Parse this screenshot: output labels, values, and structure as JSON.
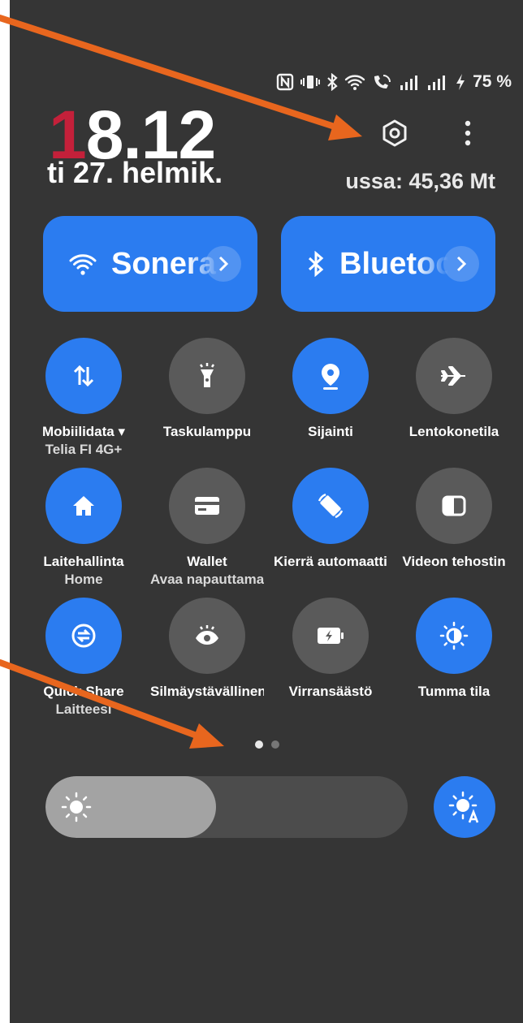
{
  "status_bar": {
    "battery_percent": "75 %",
    "icons": [
      "nfc-icon",
      "vibrate-icon",
      "bluetooth-icon",
      "wifi-icon",
      "wifi-calling-icon",
      "signal-icon",
      "signal-icon",
      "charging-icon"
    ]
  },
  "header": {
    "clock_first": "1",
    "clock_rest": "8.12",
    "date": "ti 27. helmik.",
    "data_usage": "ussa: 45,36 Mt"
  },
  "big_tiles": {
    "wifi": {
      "label": "Sonera",
      "icon": "wifi-icon"
    },
    "bluetooth": {
      "label": "Bluetooth",
      "icon": "bluetooth-icon"
    }
  },
  "quick_settings": [
    {
      "label": "Mobiilidata ▾",
      "sub": "Telia FI 4G+",
      "icon": "mobile-data-icon",
      "state": "on"
    },
    {
      "label": "Taskulamppu",
      "sub": "",
      "icon": "flashlight-icon",
      "state": "off"
    },
    {
      "label": "Sijainti",
      "sub": "",
      "icon": "location-icon",
      "state": "on"
    },
    {
      "label": "Lentokonetila",
      "sub": "",
      "icon": "airplane-icon",
      "state": "off"
    },
    {
      "label": "Laitehallinta",
      "sub": "Home",
      "icon": "home-icon",
      "state": "on"
    },
    {
      "label": "Wallet",
      "sub": "Avaa napauttamalla",
      "icon": "wallet-icon",
      "state": "off"
    },
    {
      "label": "Kierrä automaattisesti",
      "sub": "",
      "icon": "auto-rotate-icon",
      "state": "on"
    },
    {
      "label": "Videon tehostin",
      "sub": "",
      "icon": "video-enhancer-icon",
      "state": "off"
    },
    {
      "label": "Quick Share",
      "sub": "Laitteesi",
      "icon": "quick-share-icon",
      "state": "on"
    },
    {
      "label": "Silmäystävällinen",
      "sub": "",
      "icon": "eye-comfort-icon",
      "state": "off"
    },
    {
      "label": "Virransäästö",
      "sub": "",
      "icon": "power-saving-icon",
      "state": "off"
    },
    {
      "label": "Tumma tila",
      "sub": "",
      "icon": "dark-mode-icon",
      "state": "on"
    }
  ],
  "pager": {
    "pages": 2,
    "current": 1
  },
  "brightness": {
    "level_percent": 47,
    "auto_icon": "auto-brightness-icon"
  },
  "colors": {
    "panel": "#353535",
    "accent": "#2b7cf0",
    "tile_off": "#5a5a5a",
    "clock_accent": "#c4203a",
    "annotation_arrow": "#e8661e"
  }
}
